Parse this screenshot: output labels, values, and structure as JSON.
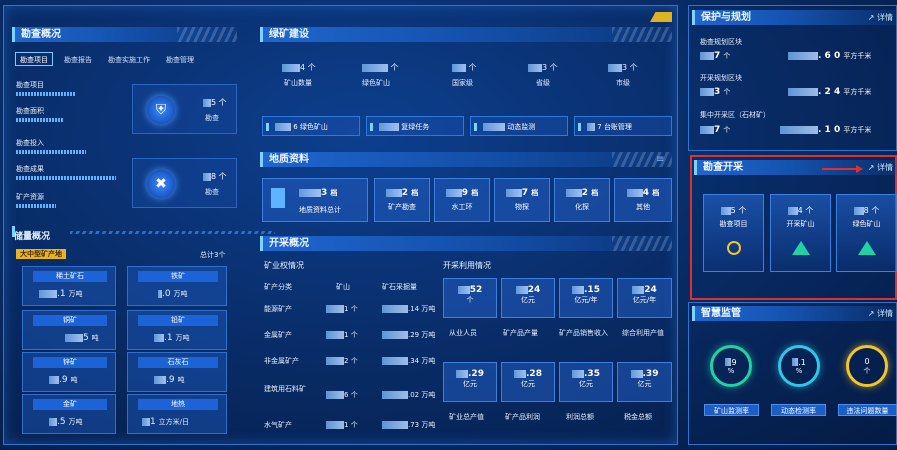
{
  "panels": {
    "survey": "勘查概况",
    "green": "绿矿建设",
    "geo": "地质资料",
    "mining": "开采概况",
    "protect": "保护与规划",
    "explore": "勘查开采",
    "smart": "智慧监管"
  },
  "detail_label": "详情",
  "survey_tabs": [
    "勘查项目",
    "勘查报告",
    "勘查实施工作",
    "勘查管理"
  ],
  "survey_rows": [
    "勘查项目",
    "勘查面积",
    "勘查投入",
    "勘查成果",
    "矿产资源"
  ],
  "survey_badges": [
    {
      "value": "5",
      "unit": "个",
      "label": "勘查"
    },
    {
      "value": "8",
      "unit": "个",
      "label": "勘查"
    }
  ],
  "reserve": {
    "title": "储量概况",
    "tag": "大中型矿产地",
    "count": "总计3个",
    "items": [
      {
        "name": "稀土矿石",
        "value": ".1",
        "unit": "万吨"
      },
      {
        "name": "铁矿",
        "value": ".0",
        "unit": "万吨"
      },
      {
        "name": "铜矿",
        "value": "5",
        "unit": "吨"
      },
      {
        "name": "铅矿",
        "value": ".1",
        "unit": "万吨"
      },
      {
        "name": "锌矿",
        "value": ".9",
        "unit": "吨"
      },
      {
        "name": "石灰石",
        "value": ".9",
        "unit": "吨"
      },
      {
        "name": "金矿",
        "value": ".5",
        "unit": "万吨"
      },
      {
        "name": "地热",
        "value": "1",
        "unit": "立方米/日"
      }
    ]
  },
  "green_items": [
    {
      "value": "4",
      "unit": "个",
      "label": "矿山数量"
    },
    {
      "value": "",
      "unit": "个",
      "label": "绿色矿山"
    },
    {
      "value": "",
      "unit": "个",
      "label": "国家级"
    },
    {
      "value": "3",
      "unit": "个",
      "label": "省级"
    },
    {
      "value": "3",
      "unit": "个",
      "label": "市级"
    }
  ],
  "green_pills": [
    {
      "value": "6",
      "label": "绿色矿山"
    },
    {
      "value": "",
      "label": "复绿任务"
    },
    {
      "value": "",
      "label": "动态监测"
    },
    {
      "value": "7",
      "label": "台账管理"
    }
  ],
  "geo_items": [
    {
      "value": "3",
      "unit": "档",
      "label": "地质资料总计"
    },
    {
      "value": "2",
      "unit": "档",
      "label": "矿产勘查"
    },
    {
      "value": "9",
      "unit": "档",
      "label": "水工环"
    },
    {
      "value": "7",
      "unit": "档",
      "label": "物探"
    },
    {
      "value": "2",
      "unit": "档",
      "label": "化探"
    },
    {
      "value": "4",
      "unit": "档",
      "label": "其他"
    }
  ],
  "mining": {
    "sub1": "矿业权情况",
    "sub2": "开采利用情况",
    "headers": [
      "矿产分类",
      "矿山",
      "矿石采掘量"
    ],
    "rows": [
      {
        "name": "能源矿产",
        "count": "1",
        "ucount": "个",
        "amount": ".14",
        "unit": "万吨"
      },
      {
        "name": "金属矿产",
        "count": "1",
        "ucount": "个",
        "amount": ".29",
        "unit": "万吨"
      },
      {
        "name": "非金属矿产",
        "count": "2",
        "ucount": "个",
        "amount": ".34",
        "unit": "万吨"
      },
      {
        "name": "建筑用石料矿",
        "count": "6",
        "ucount": "个",
        "amount": ".02",
        "unit": "万吨"
      },
      {
        "name": "水气矿产",
        "count": "1",
        "ucount": "个",
        "amount": ".73",
        "unit": "万吨"
      }
    ],
    "tiles_top": [
      {
        "value": "52",
        "unit": "个",
        "label": "从业人员"
      },
      {
        "value": "24",
        "unit": "亿元",
        "label": "矿产品产量"
      },
      {
        "value": ".15",
        "unit": "亿元/年",
        "label": "矿产品销售收入"
      },
      {
        "value": "24",
        "unit": "亿元/年",
        "label": "综合利用产值"
      }
    ],
    "tiles_bottom": [
      {
        "value": ".29",
        "unit": "亿元",
        "label": "矿业总产值"
      },
      {
        "value": ".28",
        "unit": "亿元",
        "label": "矿产品利润"
      },
      {
        "value": ".35",
        "unit": "亿元",
        "label": "利润总额"
      },
      {
        "value": ".39",
        "unit": "亿元",
        "label": "税金总额"
      }
    ]
  },
  "protect": {
    "rows": [
      {
        "name": "勘查规划区块",
        "count": "7",
        "unit": "个",
        "area": ". 6 0",
        "aunit": "平方千米"
      },
      {
        "name": "开采规划区块",
        "count": "3",
        "unit": "个",
        "area": ". 2 4",
        "aunit": "平方千米"
      },
      {
        "name": "集中开采区（石材矿）",
        "count": "7",
        "unit": "个",
        "area": ". 1 0",
        "aunit": "平方千米"
      }
    ]
  },
  "explore_cards": [
    {
      "value": "5",
      "unit": "个",
      "label": "勘查项目"
    },
    {
      "value": "4",
      "unit": "个",
      "label": "开采矿山"
    },
    {
      "value": "8",
      "unit": "个",
      "label": "绿色矿山"
    }
  ],
  "smart": [
    {
      "value": "9",
      "unit": "%",
      "label": "矿山监测率"
    },
    {
      "value": ".1",
      "unit": "%",
      "label": "动态检测率"
    },
    {
      "value": "0",
      "unit": "个",
      "label": "违法问题数量"
    }
  ]
}
